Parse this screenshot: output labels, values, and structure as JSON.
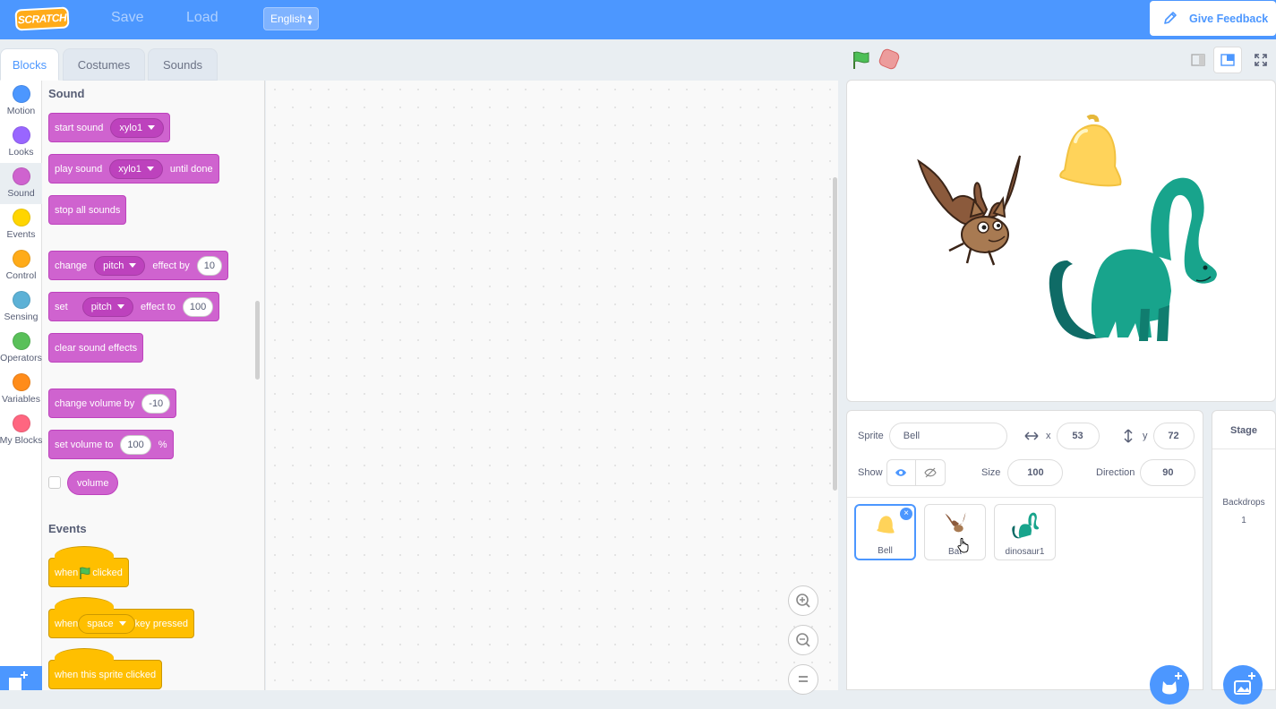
{
  "menubar": {
    "logo_text": "SCRATCH",
    "save_label": "Save",
    "load_label": "Load",
    "language": "English",
    "feedback_label": "Give Feedback"
  },
  "tabs": [
    {
      "label": "Blocks",
      "active": true
    },
    {
      "label": "Costumes",
      "active": false
    },
    {
      "label": "Sounds",
      "active": false
    }
  ],
  "categories": [
    {
      "label": "Motion",
      "color": "#4c97ff"
    },
    {
      "label": "Looks",
      "color": "#9966ff"
    },
    {
      "label": "Sound",
      "color": "#cf63cf",
      "selected": true
    },
    {
      "label": "Events",
      "color": "#ffd500"
    },
    {
      "label": "Control",
      "color": "#ffab19"
    },
    {
      "label": "Sensing",
      "color": "#5cb1d6"
    },
    {
      "label": "Operators",
      "color": "#59c059"
    },
    {
      "label": "Variables",
      "color": "#ff8c1a"
    },
    {
      "label": "My Blocks",
      "color": "#ff6680"
    }
  ],
  "palette": {
    "sound_title": "Sound",
    "start_sound": {
      "label": "start sound",
      "sound": "xylo1"
    },
    "play_sound": {
      "label": "play sound",
      "sound": "xylo1",
      "suffix": "until done"
    },
    "stop_all": "stop all sounds",
    "change_effect": {
      "label": "change",
      "effect": "pitch",
      "mid": "effect by",
      "value": "10"
    },
    "set_effect": {
      "label": "set",
      "effect": "pitch",
      "mid": "effect to",
      "value": "100"
    },
    "clear_effects": "clear sound effects",
    "change_volume": {
      "label": "change volume by",
      "value": "-10"
    },
    "set_volume": {
      "label": "set volume to",
      "value": "100",
      "unit": "%"
    },
    "volume_reporter": "volume",
    "events_title": "Events",
    "when_flag": {
      "pre": "when",
      "post": "clicked"
    },
    "when_key": {
      "pre": "when",
      "key": "space",
      "post": "key pressed"
    },
    "when_sprite": "when this sprite clicked"
  },
  "sprite_info": {
    "sprite_label": "Sprite",
    "sprite_name": "Bell",
    "x_label": "x",
    "x_value": "53",
    "y_label": "y",
    "y_value": "72",
    "show_label": "Show",
    "size_label": "Size",
    "size_value": "100",
    "direction_label": "Direction",
    "direction_value": "90"
  },
  "sprites": [
    {
      "name": "Bell",
      "selected": true
    },
    {
      "name": "Bat",
      "selected": false
    },
    {
      "name": "dinosaur1",
      "selected": false
    }
  ],
  "stage_panel": {
    "title": "Stage",
    "backdrops_label": "Backdrops",
    "backdrops_count": "1"
  },
  "colors": {
    "accent": "#4c97ff",
    "sound": "#cf63cf",
    "events": "#ffbf00"
  }
}
